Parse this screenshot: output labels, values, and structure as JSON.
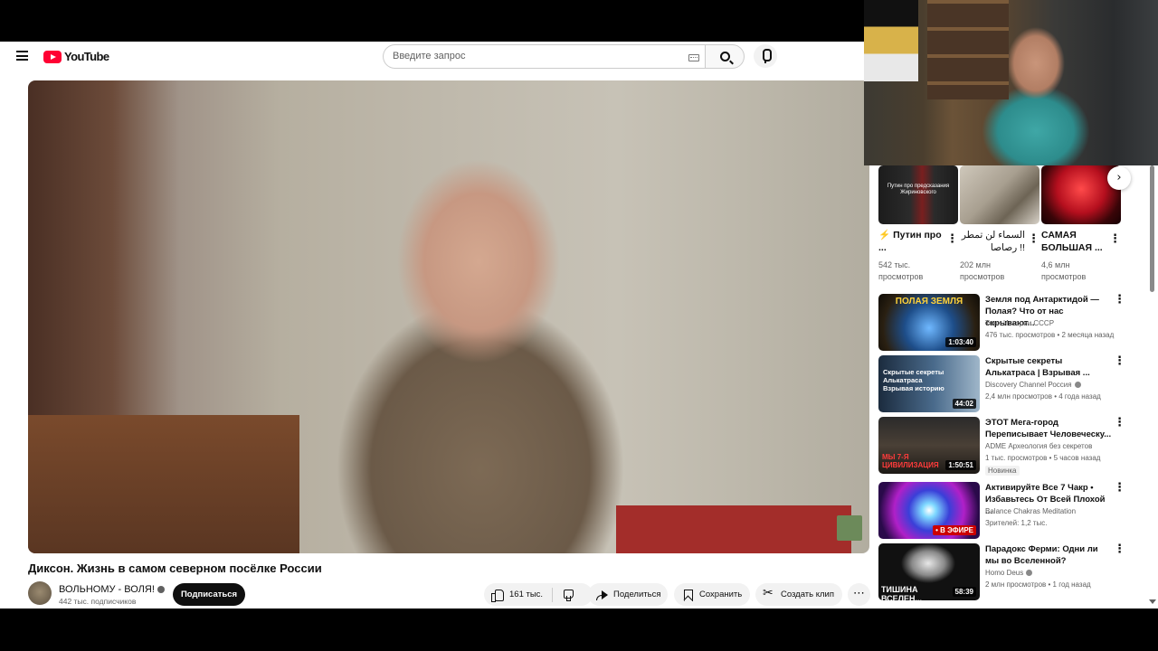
{
  "header": {
    "logo_text": "YouTube",
    "search_placeholder": "Введите запрос"
  },
  "video": {
    "title": "Диксон. Жизнь в самом северном посёлке России",
    "channel": "ВОЛЬНОМУ - ВОЛЯ!",
    "subscribers": "442 тыс. подписчиков",
    "subscribe_label": "Подписаться",
    "likes": "161 тыс.",
    "share_label": "Поделиться",
    "save_label": "Сохранить",
    "clip_label": "Создать клип"
  },
  "shorts": [
    {
      "title": "Путин про ...",
      "views": "542 тыс. просмотров",
      "thumb_text": "Путин про предсказания Жириновского",
      "hot": true
    },
    {
      "title": "السماء لن تمطر رصاصا !!",
      "views": "202 млн просмотров",
      "thumb_text": ""
    },
    {
      "title": "САМАЯ БОЛЬШАЯ ...",
      "views": "4,6 млн просмотров",
      "thumb_text": ""
    }
  ],
  "related": [
    {
      "title": "Земля под Антарктидой — Полая? Что от нас скрывают...",
      "channel": "Тени Истории СССР",
      "meta": "476 тыс. просмотров • 2 месяца назад",
      "duration": "1:03:40",
      "thumb_text": "ПОЛАЯ ЗЕМЛЯ",
      "verified": false,
      "badge": ""
    },
    {
      "title": "Скрытые секреты Алькатраса | Взрывая ...",
      "channel": "Discovery Channel Россия",
      "meta": "2,4 млн просмотров • 4 года назад",
      "duration": "44:02",
      "thumb_text": "Скрытые секреты Алькатраса Взрывая историю",
      "verified": true,
      "badge": ""
    },
    {
      "title": "ЭТОТ Мега-город Переписывает Человеческу...",
      "channel": "ADME Археология без секретов",
      "meta": "1 тыс. просмотров • 5 часов назад",
      "duration": "1:50:51",
      "thumb_text": "МЫ 7-Я ЦИВИЛИЗАЦИЯ",
      "verified": false,
      "badge": "Новинка"
    },
    {
      "title": "Активируйте Все 7 Чакр • Избавьтесь От Всей Плохой ...",
      "channel": "Balance Chakras Meditation",
      "meta": "Зрителей: 1,2 тыс.",
      "duration": "• В ЭФИРЕ",
      "thumb_text": "",
      "verified": false,
      "badge": ""
    },
    {
      "title": "Парадокс Ферми: Одни ли мы во Вселенной?",
      "channel": "Homo Deus",
      "meta": "2 млн просмотров • 1 год назад",
      "duration": "58:39",
      "thumb_text": "ТИШИНА ВСЕЛЕН...",
      "verified": true,
      "badge": ""
    }
  ],
  "colors": {
    "accent": "#ff0033",
    "live": "#cc0000"
  }
}
